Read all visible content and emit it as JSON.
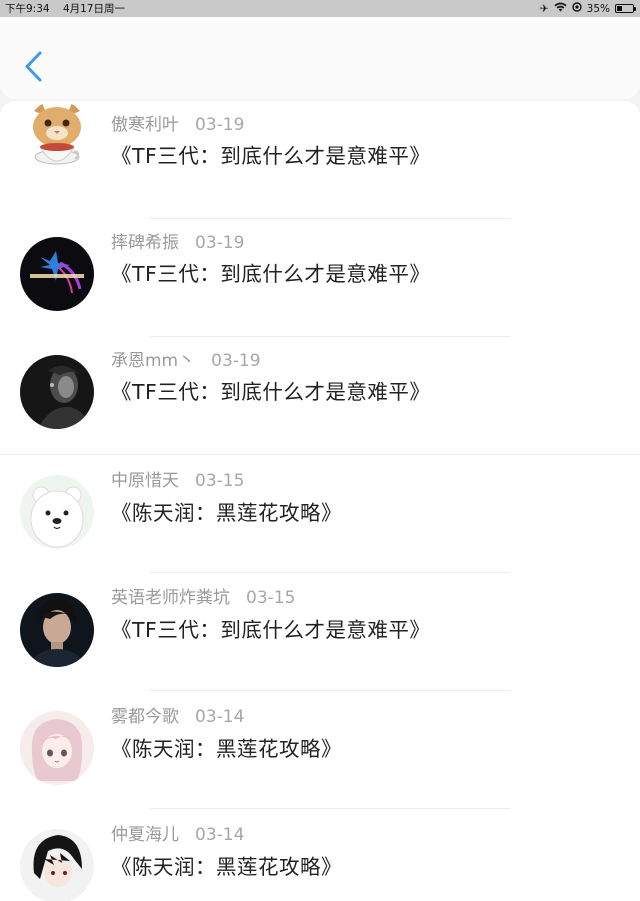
{
  "status_bar": {
    "time": "下午9:34",
    "date": "4月17日周一",
    "battery_percent": "35%",
    "battery_level": 0.35
  },
  "header": {
    "back_icon": "chevron-left-icon",
    "accent_color": "#3d9ae8"
  },
  "items": [
    {
      "name": "傲寒利叶",
      "date": "03-19",
      "title": "《TF三代：到底什么才是意难平》",
      "avatar": "cat-with-cup"
    },
    {
      "name": "摔碑希振",
      "date": "03-19",
      "title": "《TF三代：到底什么才是意难平》",
      "avatar": "dark-star"
    },
    {
      "name": "承恩mm丶",
      "date": "03-19",
      "title": "《TF三代：到底什么才是意难平》",
      "avatar": "bw-photo"
    },
    {
      "name": "中原惜天",
      "date": "03-15",
      "title": "《陈天润：黑莲花攻略》",
      "avatar": "white-bear"
    },
    {
      "name": "英语老师炸粪坑",
      "date": "03-15",
      "title": "《TF三代：到底什么才是意难平》",
      "avatar": "portrait"
    },
    {
      "name": "雾都今歌",
      "date": "03-14",
      "title": "《陈天润：黑莲花攻略》",
      "avatar": "anime-girl"
    },
    {
      "name": "仲夏海儿",
      "date": "03-14",
      "title": "《陈天润：黑莲花攻略》",
      "avatar": "anime-dark-hair"
    }
  ]
}
